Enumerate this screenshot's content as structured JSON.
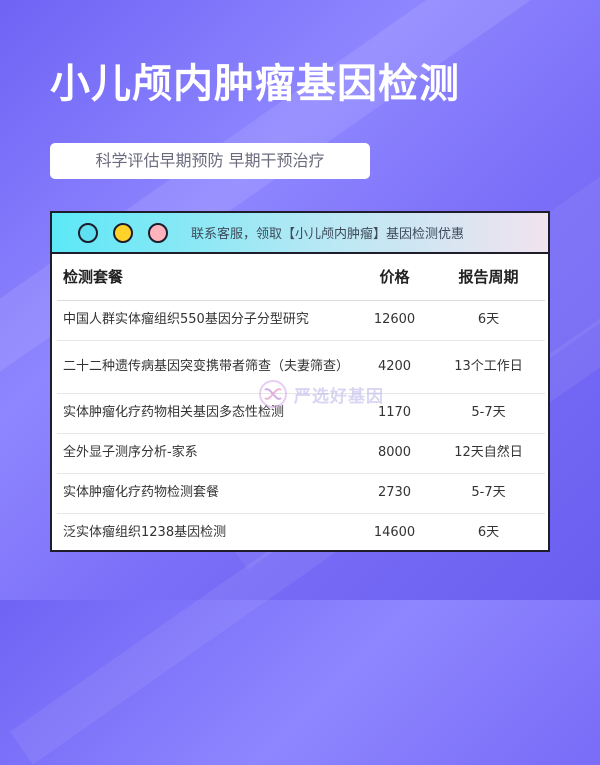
{
  "header": {
    "title": "小儿颅内肿瘤基因检测",
    "subtitle": "科学评估早期预防 早期干预治疗"
  },
  "window": {
    "notice": "联系客服，领取【小儿颅内肿瘤】基因检测优惠",
    "dots": [
      "cyan",
      "yellow",
      "pink"
    ]
  },
  "table": {
    "headers": [
      "检测套餐",
      "价格",
      "报告周期"
    ],
    "rows": [
      {
        "name": "中国人群实体瘤组织550基因分子分型研究",
        "price": "12600",
        "period": "6天"
      },
      {
        "name": "二十二种遗传病基因突变携带者筛查（夫妻筛查）",
        "price": "4200",
        "period": "13个工作日"
      },
      {
        "name": "实体肿瘤化疗药物相关基因多态性检测",
        "price": "1170",
        "period": "5-7天"
      },
      {
        "name": "全外显子测序分析-家系",
        "price": "8000",
        "period": "12天自然日"
      },
      {
        "name": "实体肿瘤化疗药物检测套餐",
        "price": "2730",
        "period": "5-7天"
      },
      {
        "name": "泛实体瘤组织1238基因检测",
        "price": "14600",
        "period": "6天"
      }
    ]
  },
  "watermark": {
    "text": "严选好基因",
    "color": "#b8b4e6"
  },
  "colors": {
    "background": "#7b6ff8",
    "titlebar_start": "#5ce8f6",
    "titlebar_end": "#f1e3ef",
    "border": "#1d1d2b"
  }
}
